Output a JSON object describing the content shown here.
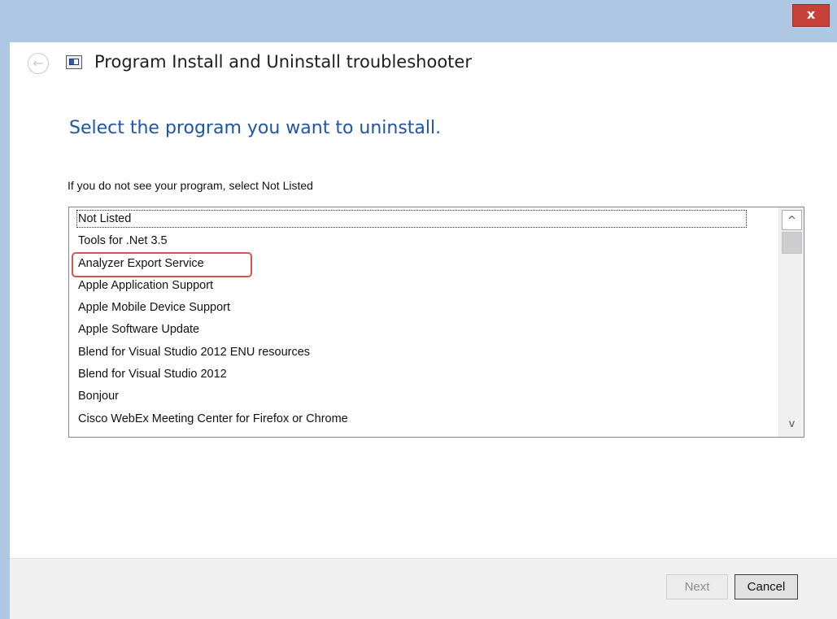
{
  "window": {
    "title": "Program Install and Uninstall troubleshooter",
    "close_glyph": "x",
    "back_glyph": "←"
  },
  "page": {
    "heading": "Select the program you want to uninstall.",
    "instruction": "If you do not see your program, select Not Listed"
  },
  "programs": [
    "Not Listed",
    "Tools for .Net 3.5",
    "Analyzer Export Service",
    "Apple Application Support",
    "Apple Mobile Device Support",
    "Apple Software Update",
    "Blend for Visual Studio 2012 ENU resources",
    "Blend for Visual Studio 2012",
    "Bonjour",
    "Cisco WebEx Meeting Center for Firefox or Chrome"
  ],
  "highlighted_program": "Analyzer Export Service",
  "scrollbar": {
    "up_glyph": "^",
    "down_glyph": "v"
  },
  "buttons": {
    "next": "Next",
    "cancel": "Cancel"
  },
  "colors": {
    "title_bar": "#aec8e4",
    "close_button": "#c7403a",
    "heading": "#1f55a8",
    "highlight_outline": "#d9534f"
  },
  "icons": {
    "close": "close-icon",
    "back": "back-arrow-icon",
    "app": "troubleshooter-app-icon",
    "scroll_up": "chevron-up-icon",
    "scroll_down": "chevron-down-icon"
  }
}
